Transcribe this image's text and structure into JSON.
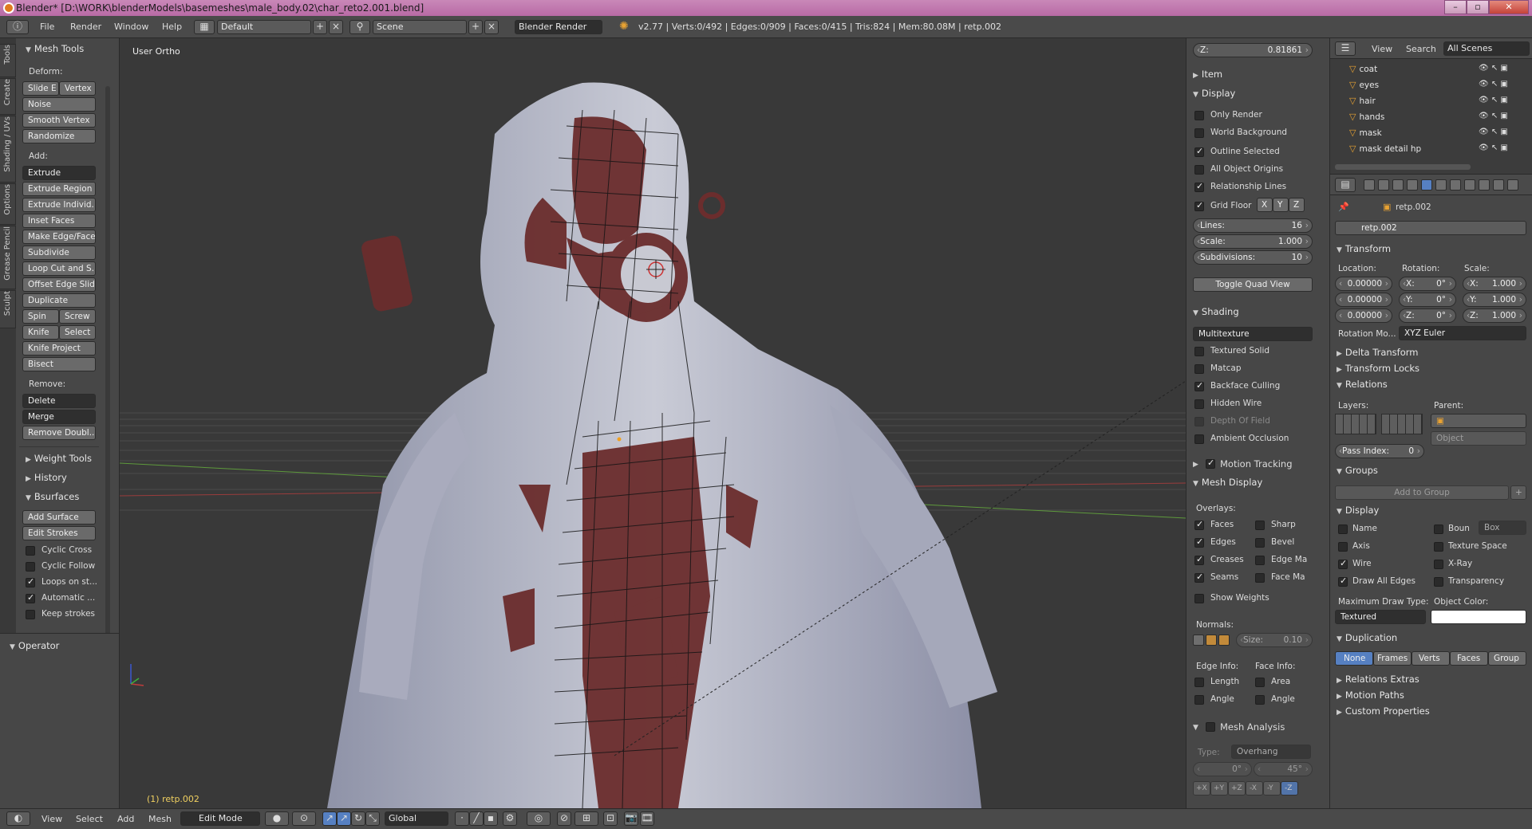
{
  "title": "Blender* [D:\\WORK\\blenderModels\\basemeshes\\male_body.02\\char_reto2.001.blend]",
  "menus": [
    "File",
    "Render",
    "Window",
    "Help"
  ],
  "layout": "Default",
  "scene": "Scene",
  "render_engine": "Blender Render",
  "stats": "v2.77 | Verts:0/492 | Edges:0/909 | Faces:0/415 | Tris:824 | Mem:80.08M | retp.002",
  "left_tabs": [
    "Tools",
    "Create",
    "Shading / UVs",
    "Options",
    "Grease Pencil",
    "Sculpt"
  ],
  "tools": {
    "header": "Mesh Tools",
    "deform_label": "Deform:",
    "slide_e": "Slide E",
    "vertex": "Vertex",
    "noise": "Noise",
    "smooth_vertex": "Smooth Vertex",
    "randomize": "Randomize",
    "add_label": "Add:",
    "extrude": "Extrude",
    "extrude_region": "Extrude Region",
    "extrude_indiv": "Extrude Individ...",
    "inset_faces": "Inset Faces",
    "make_edge_face": "Make Edge/Face",
    "subdivide": "Subdivide",
    "loop_cut": "Loop Cut and S...",
    "offset_edge": "Offset Edge Slide",
    "duplicate": "Duplicate",
    "spin": "Spin",
    "screw": "Screw",
    "knife": "Knife",
    "select": "Select",
    "knife_project": "Knife Project",
    "bisect": "Bisect",
    "remove_label": "Remove:",
    "delete": "Delete",
    "merge": "Merge",
    "remove_doubles": "Remove Doubl...",
    "weight_tools": "Weight Tools",
    "history": "History",
    "bsurfaces": "Bsurfaces",
    "add_surface": "Add Surface",
    "edit_strokes": "Edit Strokes",
    "cyclic_cross": "Cyclic Cross",
    "cyclic_follow": "Cyclic Follow",
    "loops_on_strokes": "Loops on st...",
    "automatic": "Automatic ...",
    "keep_strokes": "Keep strokes",
    "operator": "Operator"
  },
  "viewport": {
    "view_label": "User Ortho",
    "object_label": "(1) retp.002"
  },
  "props": {
    "z_label": "Z:",
    "z_value": "0.81861",
    "item": "Item",
    "display": "Display",
    "only_render": "Only Render",
    "world_bg": "World Background",
    "outline_selected": "Outline Selected",
    "all_origins": "All Object Origins",
    "relationship_lines": "Relationship Lines",
    "grid_floor": "Grid Floor",
    "x": "X",
    "y": "Y",
    "z": "Z",
    "lines_label": "Lines:",
    "lines_value": "16",
    "scale_label": "Scale:",
    "scale_value": "1.000",
    "subdiv_label": "Subdivisions:",
    "subdiv_value": "10",
    "toggle_quad": "Toggle Quad View",
    "shading": "Shading",
    "multitexture": "Multitexture",
    "textured_solid": "Textured Solid",
    "matcap": "Matcap",
    "backface": "Backface Culling",
    "hidden_wire": "Hidden Wire",
    "dof": "Depth Of Field",
    "ao": "Ambient Occlusion",
    "motion_tracking": "Motion Tracking",
    "mesh_display": "Mesh Display",
    "overlays": "Overlays:",
    "faces": "Faces",
    "sharp": "Sharp",
    "edges": "Edges",
    "bevel": "Bevel",
    "creases": "Creases",
    "edge_ma": "Edge Ma",
    "seams": "Seams",
    "face_ma": "Face Ma",
    "show_weights": "Show Weights",
    "normals": "Normals:",
    "size_label": "Size:",
    "size_value": "0.10",
    "edge_info": "Edge Info:",
    "face_info": "Face Info:",
    "length": "Length",
    "area": "Area",
    "angle": "Angle",
    "angle2": "Angle",
    "mesh_analysis": "Mesh Analysis",
    "type_label": "Type:",
    "type_value": "Overhang",
    "deg_min": "0°",
    "deg_max": "45°",
    "axes": [
      "+X",
      "+Y",
      "+Z",
      "-X",
      "-Y",
      "-Z"
    ]
  },
  "outliner": {
    "view": "View",
    "search": "Search",
    "scenes": "All Scenes",
    "items": [
      "coat",
      "eyes",
      "hair",
      "hands",
      "mask",
      "mask detail hp"
    ]
  },
  "properties": {
    "breadcrumb": "retp.002",
    "object_name": "retp.002",
    "transform": "Transform",
    "location": "Location:",
    "rotation": "Rotation:",
    "scale": "Scale:",
    "loc": [
      "0.00000",
      "0.00000",
      "0.00000"
    ],
    "rot_labels": [
      "X:",
      "Y:",
      "Z:"
    ],
    "rot": [
      "0°",
      "0°",
      "0°"
    ],
    "scl_labels": [
      "X:",
      "Y:",
      "Z:"
    ],
    "scl": [
      "1.000",
      "1.000",
      "1.000"
    ],
    "rotation_mode_label": "Rotation Mo...",
    "rotation_mode": "XYZ Euler",
    "delta_transform": "Delta Transform",
    "transform_locks": "Transform Locks",
    "relations": "Relations",
    "layers": "Layers:",
    "parent": "Parent:",
    "parent_type": "Object",
    "pass_index_label": "Pass Index:",
    "pass_index": "0",
    "groups": "Groups",
    "add_to_group": "Add to Group",
    "display": "Display",
    "name": "Name",
    "bounds": "Boun",
    "bounds_type": "Box",
    "axis": "Axis",
    "texture_space": "Texture Space",
    "wire": "Wire",
    "xray": "X-Ray",
    "draw_all_edges": "Draw All Edges",
    "transparency": "Transparency",
    "max_draw_type_label": "Maximum Draw Type:",
    "object_color_label": "Object Color:",
    "max_draw_type": "Textured",
    "duplication": "Duplication",
    "dup_options": [
      "None",
      "Frames",
      "Verts",
      "Faces",
      "Group"
    ],
    "relations_extras": "Relations Extras",
    "motion_paths": "Motion Paths",
    "custom_properties": "Custom Properties"
  },
  "bottom": {
    "menus": [
      "View",
      "Select",
      "Add",
      "Mesh"
    ],
    "mode": "Edit Mode",
    "orientation": "Global"
  }
}
